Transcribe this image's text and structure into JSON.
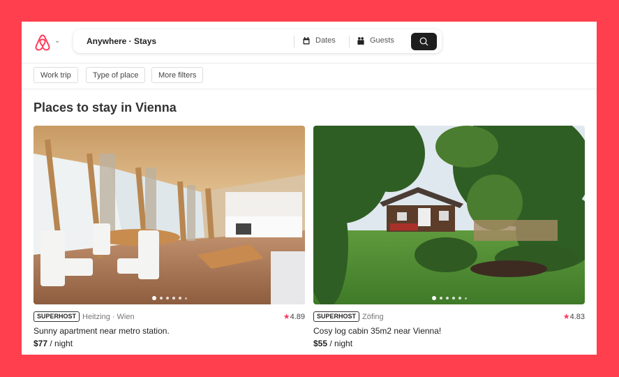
{
  "brand": {
    "name": "Airbnb",
    "accent": "#ff385c",
    "frame_color": "#ff3f4d"
  },
  "search": {
    "where_label": "Anywhere · Stays",
    "dates_label": "Dates",
    "guests_label": "Guests",
    "dates_icon": "calendar-icon",
    "guests_icon": "guests-icon",
    "search_icon": "search-icon"
  },
  "filters": [
    {
      "label": "Work trip"
    },
    {
      "label": "Type of place"
    },
    {
      "label": "More filters"
    }
  ],
  "heading": "Places to stay in Vienna",
  "listings": [
    {
      "badge": "SUPERHOST",
      "location": "Heitzing · Wien",
      "rating": "4.89",
      "title": "Sunny apartment near metro station.",
      "price": "$77",
      "price_unit": " / night",
      "photo_count_dots": 6,
      "active_photo": 1
    },
    {
      "badge": "SUPERHOST",
      "location": "Zöfing",
      "rating": "4.83",
      "title": "Cosy log cabin 35m2 near Vienna!",
      "price": "$55",
      "price_unit": " / night",
      "photo_count_dots": 6,
      "active_photo": 1
    }
  ]
}
